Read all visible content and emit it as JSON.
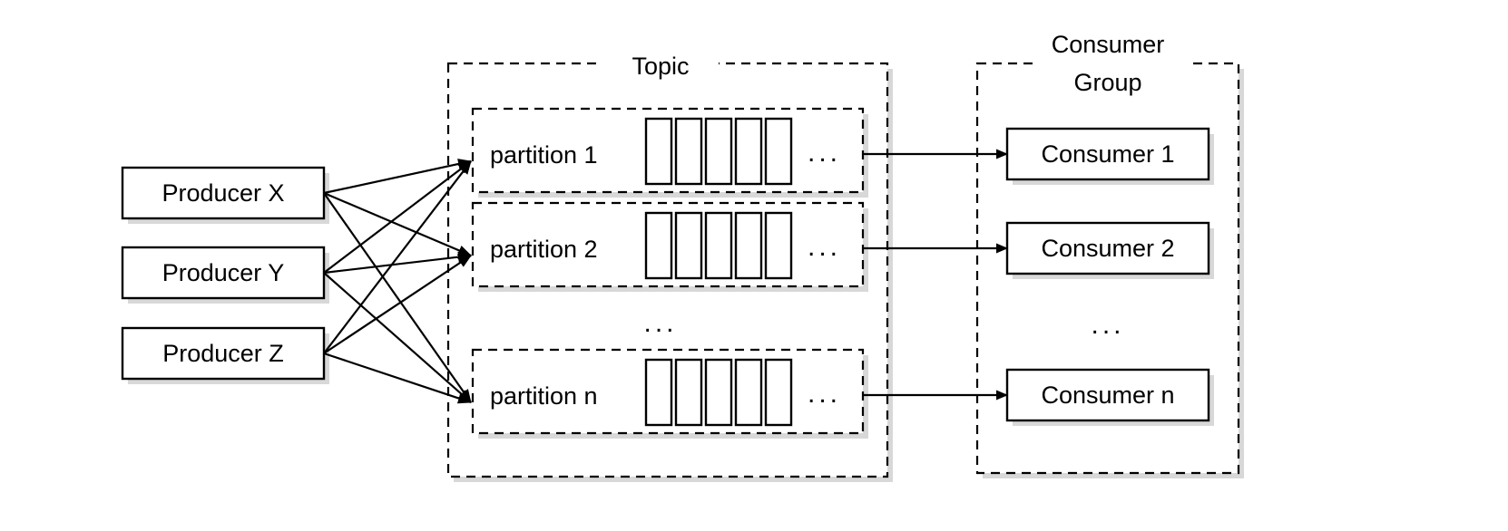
{
  "diagram": {
    "title": "Kafka topic partition and consumer group diagram",
    "colors": {
      "stroke": "#000000",
      "fill": "#ffffff",
      "shadow": "#b8b8b8"
    }
  },
  "producers": {
    "items": [
      {
        "label": "Producer X"
      },
      {
        "label": "Producer Y"
      },
      {
        "label": "Producer Z"
      }
    ]
  },
  "topic": {
    "label": "Topic",
    "ellipsis": "...",
    "partitions": [
      {
        "label": "partition 1",
        "cells": 5,
        "ellipsis": "..."
      },
      {
        "label": "partition 2",
        "cells": 5,
        "ellipsis": "..."
      },
      {
        "label": "partition n",
        "cells": 5,
        "ellipsis": "..."
      }
    ]
  },
  "consumer_group": {
    "label_line_1": "Consumer",
    "label_line_2": "Group",
    "ellipsis": "...",
    "consumers": [
      {
        "label": "Consumer 1"
      },
      {
        "label": "Consumer 2"
      },
      {
        "label": "Consumer n"
      }
    ]
  }
}
